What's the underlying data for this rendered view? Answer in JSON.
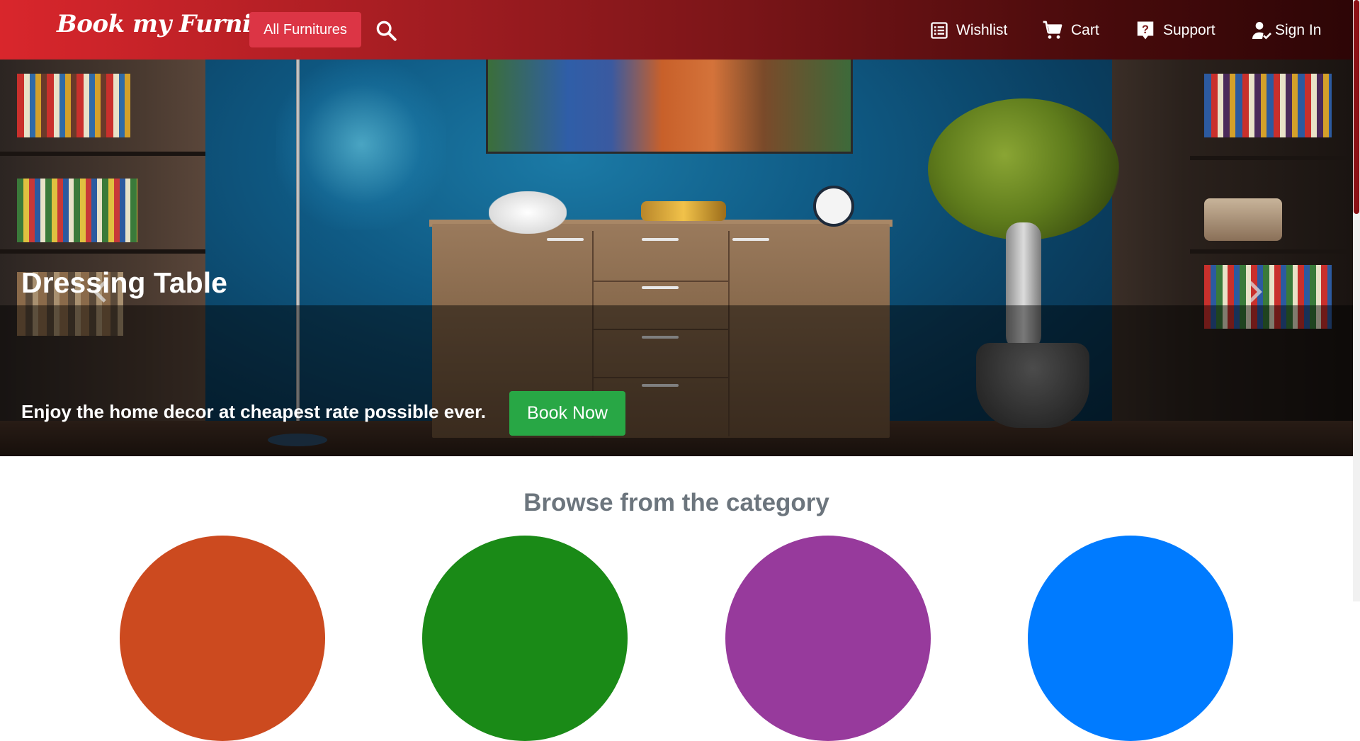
{
  "navbar": {
    "brand": "Book my Furniture",
    "all_furnitures": "All Furnitures",
    "search_icon": "search-icon",
    "items": [
      {
        "label": "Wishlist",
        "icon": "list-icon"
      },
      {
        "label": "Cart",
        "icon": "cart-icon"
      },
      {
        "label": "Support",
        "icon": "help-icon"
      },
      {
        "label": "Sign In",
        "icon": "user-check-icon"
      }
    ]
  },
  "hero": {
    "title": "Dressing Table",
    "text": "Enjoy the home decor at cheapest rate possible ever.",
    "button": "Book Now",
    "prev_icon": "chevron-left-icon",
    "next_icon": "chevron-right-icon"
  },
  "browse": {
    "title": "Browse from the category",
    "category_colors": [
      "#cc4a1f",
      "#1a8a17",
      "#973a9c",
      "#007bff"
    ]
  },
  "colors": {
    "brand_red": "#dc3545",
    "book_green": "#28a745"
  }
}
